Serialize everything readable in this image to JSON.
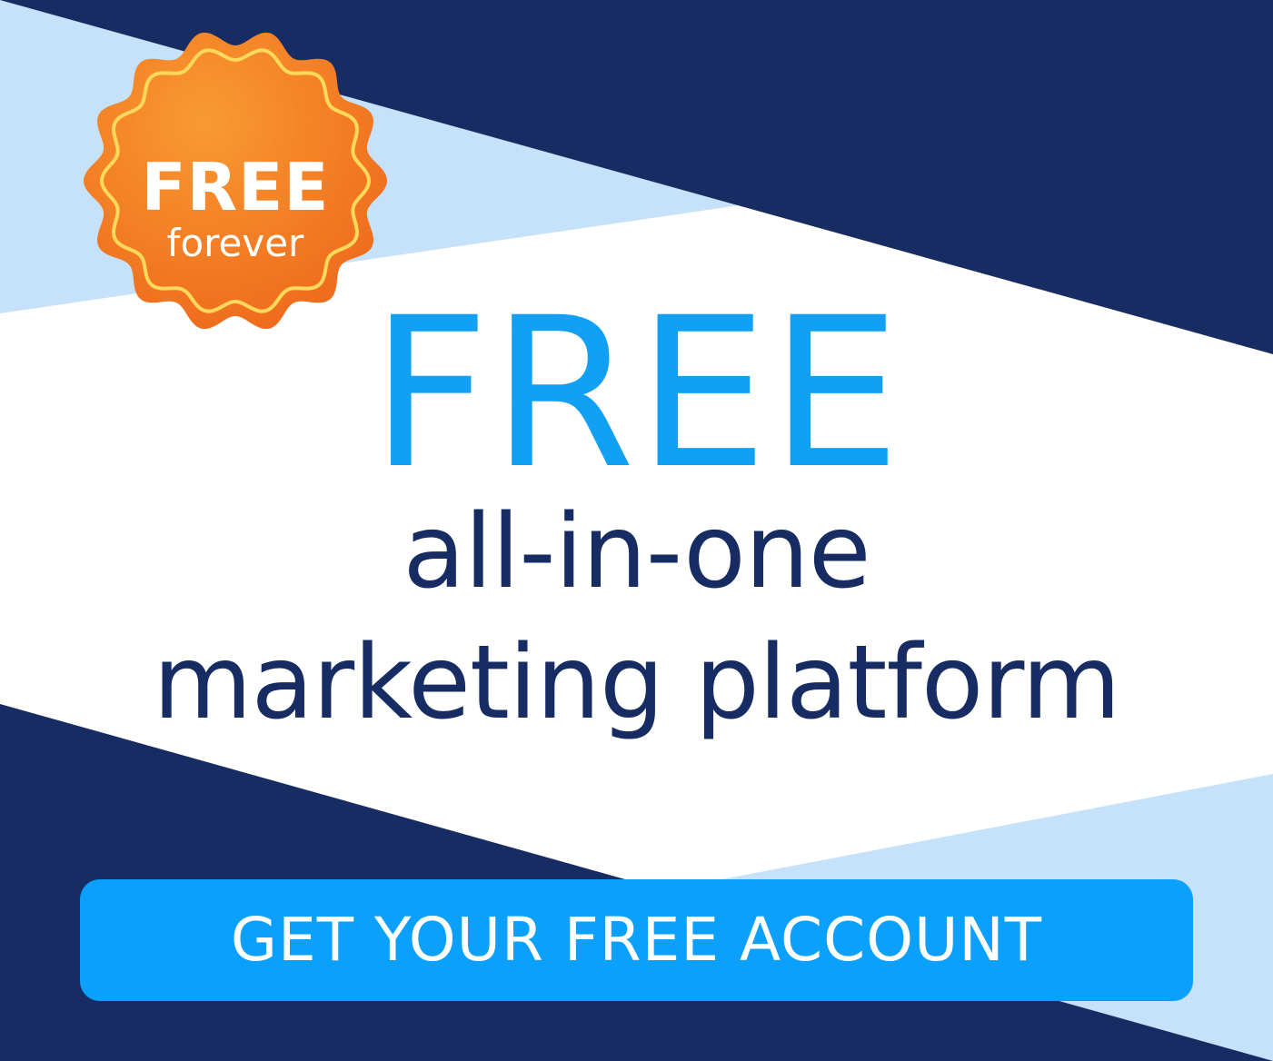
{
  "badge": {
    "title": "FREE",
    "subtitle": "forever"
  },
  "headline": {
    "free": "FREE",
    "line1": "all-in-one",
    "line2": "marketing platform"
  },
  "cta": {
    "label": "GET YOUR FREE ACCOUNT"
  },
  "colors": {
    "navy": "#172c63",
    "light_blue": "#c6e1fa",
    "accent_blue": "#12a0f5",
    "button_blue": "#0aa0fb",
    "badge_orange": "#f47a20",
    "badge_outline": "#ffd95a"
  }
}
